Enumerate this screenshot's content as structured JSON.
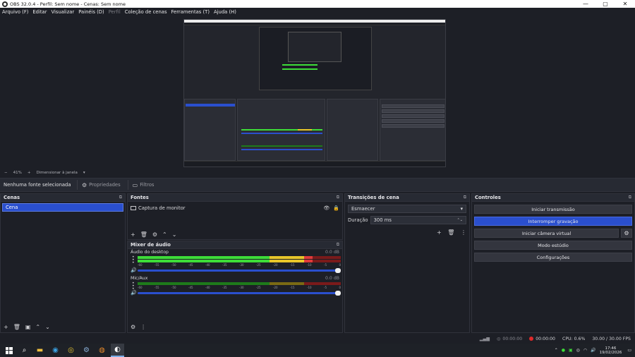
{
  "window": {
    "title": "OBS 32.0.4 - Perfil: Sem nome - Cenas: Sem nome"
  },
  "menu": [
    "Arquivo (F)",
    "Editar",
    "Visualizar",
    "Painéis (D)",
    "Perfil",
    "Coleção de cenas",
    "Ferramentas (T)",
    "Ajuda (H)"
  ],
  "preview_toolbar": {
    "zoom": "41%",
    "scale_mode": "Dimensionar à janela"
  },
  "source_bar": {
    "no_source": "Nenhuma fonte selecionada",
    "properties": "Propriedades",
    "filters": "Filtros"
  },
  "scenes": {
    "title": "Cenas",
    "items": [
      "Cena"
    ]
  },
  "sources": {
    "title": "Fontes",
    "items": [
      "Captura de monitor"
    ]
  },
  "mixer": {
    "title": "Mixer de áudio",
    "ticks": [
      "-60",
      "-55",
      "-50",
      "-45",
      "-40",
      "-35",
      "-30",
      "-25",
      "-20",
      "-15",
      "-10",
      "-5",
      "0"
    ],
    "tracks": [
      {
        "name": "Áudio do desktop",
        "db": "0.0 dB",
        "level": 0.86
      },
      {
        "name": "Mic/Aux",
        "db": "0.0 dB",
        "level": 0.0
      }
    ]
  },
  "transitions": {
    "title": "Transições de cena",
    "selected": "Esmaecer",
    "duration_label": "Duração",
    "duration_value": "300 ms"
  },
  "controls": {
    "title": "Controles",
    "start_stream": "Iniciar transmissão",
    "stop_recording": "Interromper gravação",
    "start_virtual_cam": "Iniciar câmera virtual",
    "studio_mode": "Modo estúdio",
    "settings": "Configurações"
  },
  "status": {
    "stream_time": "00:00:00",
    "rec_time": "00:00:00",
    "cpu": "CPU: 0.6%",
    "fps": "30.00 / 30.00 FPS"
  },
  "taskbar": {
    "time": "17:46",
    "date": "19/02/2026"
  }
}
